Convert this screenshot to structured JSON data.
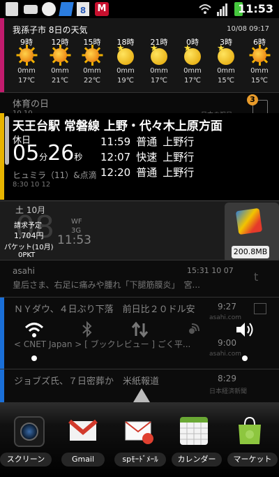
{
  "status_bar": {
    "time": "11:53",
    "badge_number": "8"
  },
  "weather": {
    "title": "我孫子市 8日の天気",
    "updated": "10/08 09:17",
    "hours": [
      {
        "time": "9時",
        "precip": "0mm",
        "temp": "17℃",
        "icon": "sun"
      },
      {
        "time": "12時",
        "precip": "0mm",
        "temp": "21℃",
        "icon": "sun"
      },
      {
        "time": "15時",
        "precip": "0mm",
        "temp": "22℃",
        "icon": "sun"
      },
      {
        "time": "18時",
        "precip": "0mm",
        "temp": "19℃",
        "icon": "moon"
      },
      {
        "time": "21時",
        "precip": "0mm",
        "temp": "17℃",
        "icon": "moon"
      },
      {
        "time": "0時",
        "precip": "0mm",
        "temp": "17℃",
        "icon": "moon"
      },
      {
        "time": "3時",
        "precip": "0mm",
        "temp": "15℃",
        "icon": "moon"
      },
      {
        "time": "6時",
        "precip": "0mm",
        "temp": "15℃",
        "icon": "sun"
      }
    ]
  },
  "calendar": {
    "title": "体育の日",
    "date": "10 10",
    "right_text": "日本の祝日",
    "badge": "3"
  },
  "train": {
    "station": "天王台駅 常磐線 上野・代々木上原方面",
    "day": "休日",
    "countdown_min": "05",
    "min_unit": "分",
    "countdown_sec": "26",
    "sec_unit": "秒",
    "sub1": "ヒュミラ（11）&点滴",
    "sub2": "8:30 10 12",
    "departures": [
      {
        "time": "11:59",
        "type": "普通",
        "dest": "上野行"
      },
      {
        "time": "12:07",
        "type": "快速",
        "dest": "上野行"
      },
      {
        "time": "12:20",
        "type": "普通",
        "dest": "上野行"
      }
    ]
  },
  "clock": {
    "date": "土 10月",
    "billing_label": "請求予定",
    "billing_amount": "1,704円",
    "packet_label": "パケット(10月)",
    "packet_value": "0PKT",
    "network": "WF",
    "network2": "3G",
    "time": "11:53",
    "bg_digits": "08",
    "memory": "200.8MB"
  },
  "news": [
    {
      "source": "asahi",
      "timestamp": "15:31 10 07",
      "headline": "皇后さま、右足に痛みや腫れ「下腿筋膜炎」　宮..."
    },
    {
      "headline": "ＮＹダウ、４日ぶり下落　前日比２０ドル安",
      "time": "9:27",
      "site": "asahi.com"
    },
    {
      "headline": "< CNET Japan > [ ブックレビュー ] ごく平...",
      "time": "9:00",
      "site": "asahi.com"
    },
    {
      "headline": "ジョブズ氏、７日密葬か　米紙報道",
      "time": "8:29",
      "site": "日本経済新聞"
    }
  ],
  "dock": {
    "apps": [
      {
        "label": "スクリーン"
      },
      {
        "label": "Gmail"
      },
      {
        "label": "spﾓｰﾄﾞﾒｰﾙ"
      },
      {
        "label": "カレンダー"
      },
      {
        "label": "マーケット"
      }
    ]
  }
}
